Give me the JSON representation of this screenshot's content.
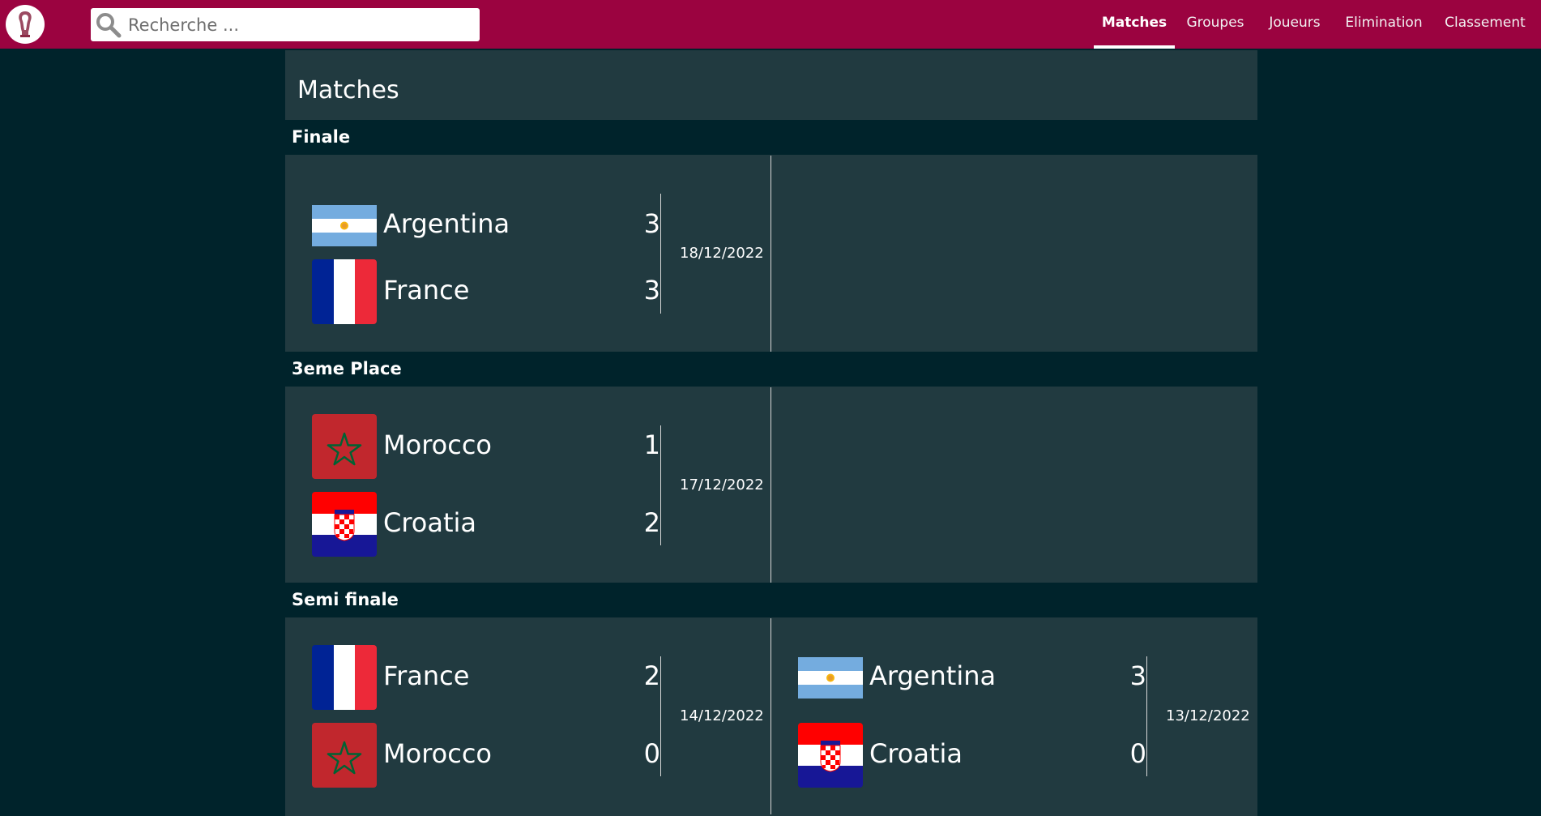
{
  "header": {
    "search_placeholder": "Recherche ...",
    "nav": [
      {
        "label": "Matches",
        "active": true
      },
      {
        "label": "Groupes",
        "active": false
      },
      {
        "label": "Joueurs",
        "active": false
      },
      {
        "label": "Elimination",
        "active": false
      },
      {
        "label": "Classement",
        "active": false
      }
    ]
  },
  "page_title": "Matches",
  "sections": [
    {
      "title": "Finale",
      "matches": [
        {
          "home": {
            "name": "Argentina",
            "score": "3",
            "flag": "argentina-flag"
          },
          "away": {
            "name": "France",
            "score": "3",
            "flag": "france-flag"
          },
          "date": "18/12/2022"
        }
      ]
    },
    {
      "title": "3eme Place",
      "matches": [
        {
          "home": {
            "name": "Morocco",
            "score": "1",
            "flag": "morocco-flag"
          },
          "away": {
            "name": "Croatia",
            "score": "2",
            "flag": "croatia-flag"
          },
          "date": "17/12/2022"
        }
      ]
    },
    {
      "title": "Semi finale",
      "matches": [
        {
          "home": {
            "name": "France",
            "score": "2",
            "flag": "france-flag"
          },
          "away": {
            "name": "Morocco",
            "score": "0",
            "flag": "morocco-flag"
          },
          "date": "14/12/2022"
        },
        {
          "home": {
            "name": "Argentina",
            "score": "3",
            "flag": "argentina-flag"
          },
          "away": {
            "name": "Croatia",
            "score": "0",
            "flag": "croatia-flag"
          },
          "date": "13/12/2022"
        }
      ]
    }
  ],
  "colors": {
    "header_bg": "#9b0340",
    "page_bg": "#00232b",
    "panel_bg": "#213a40"
  }
}
